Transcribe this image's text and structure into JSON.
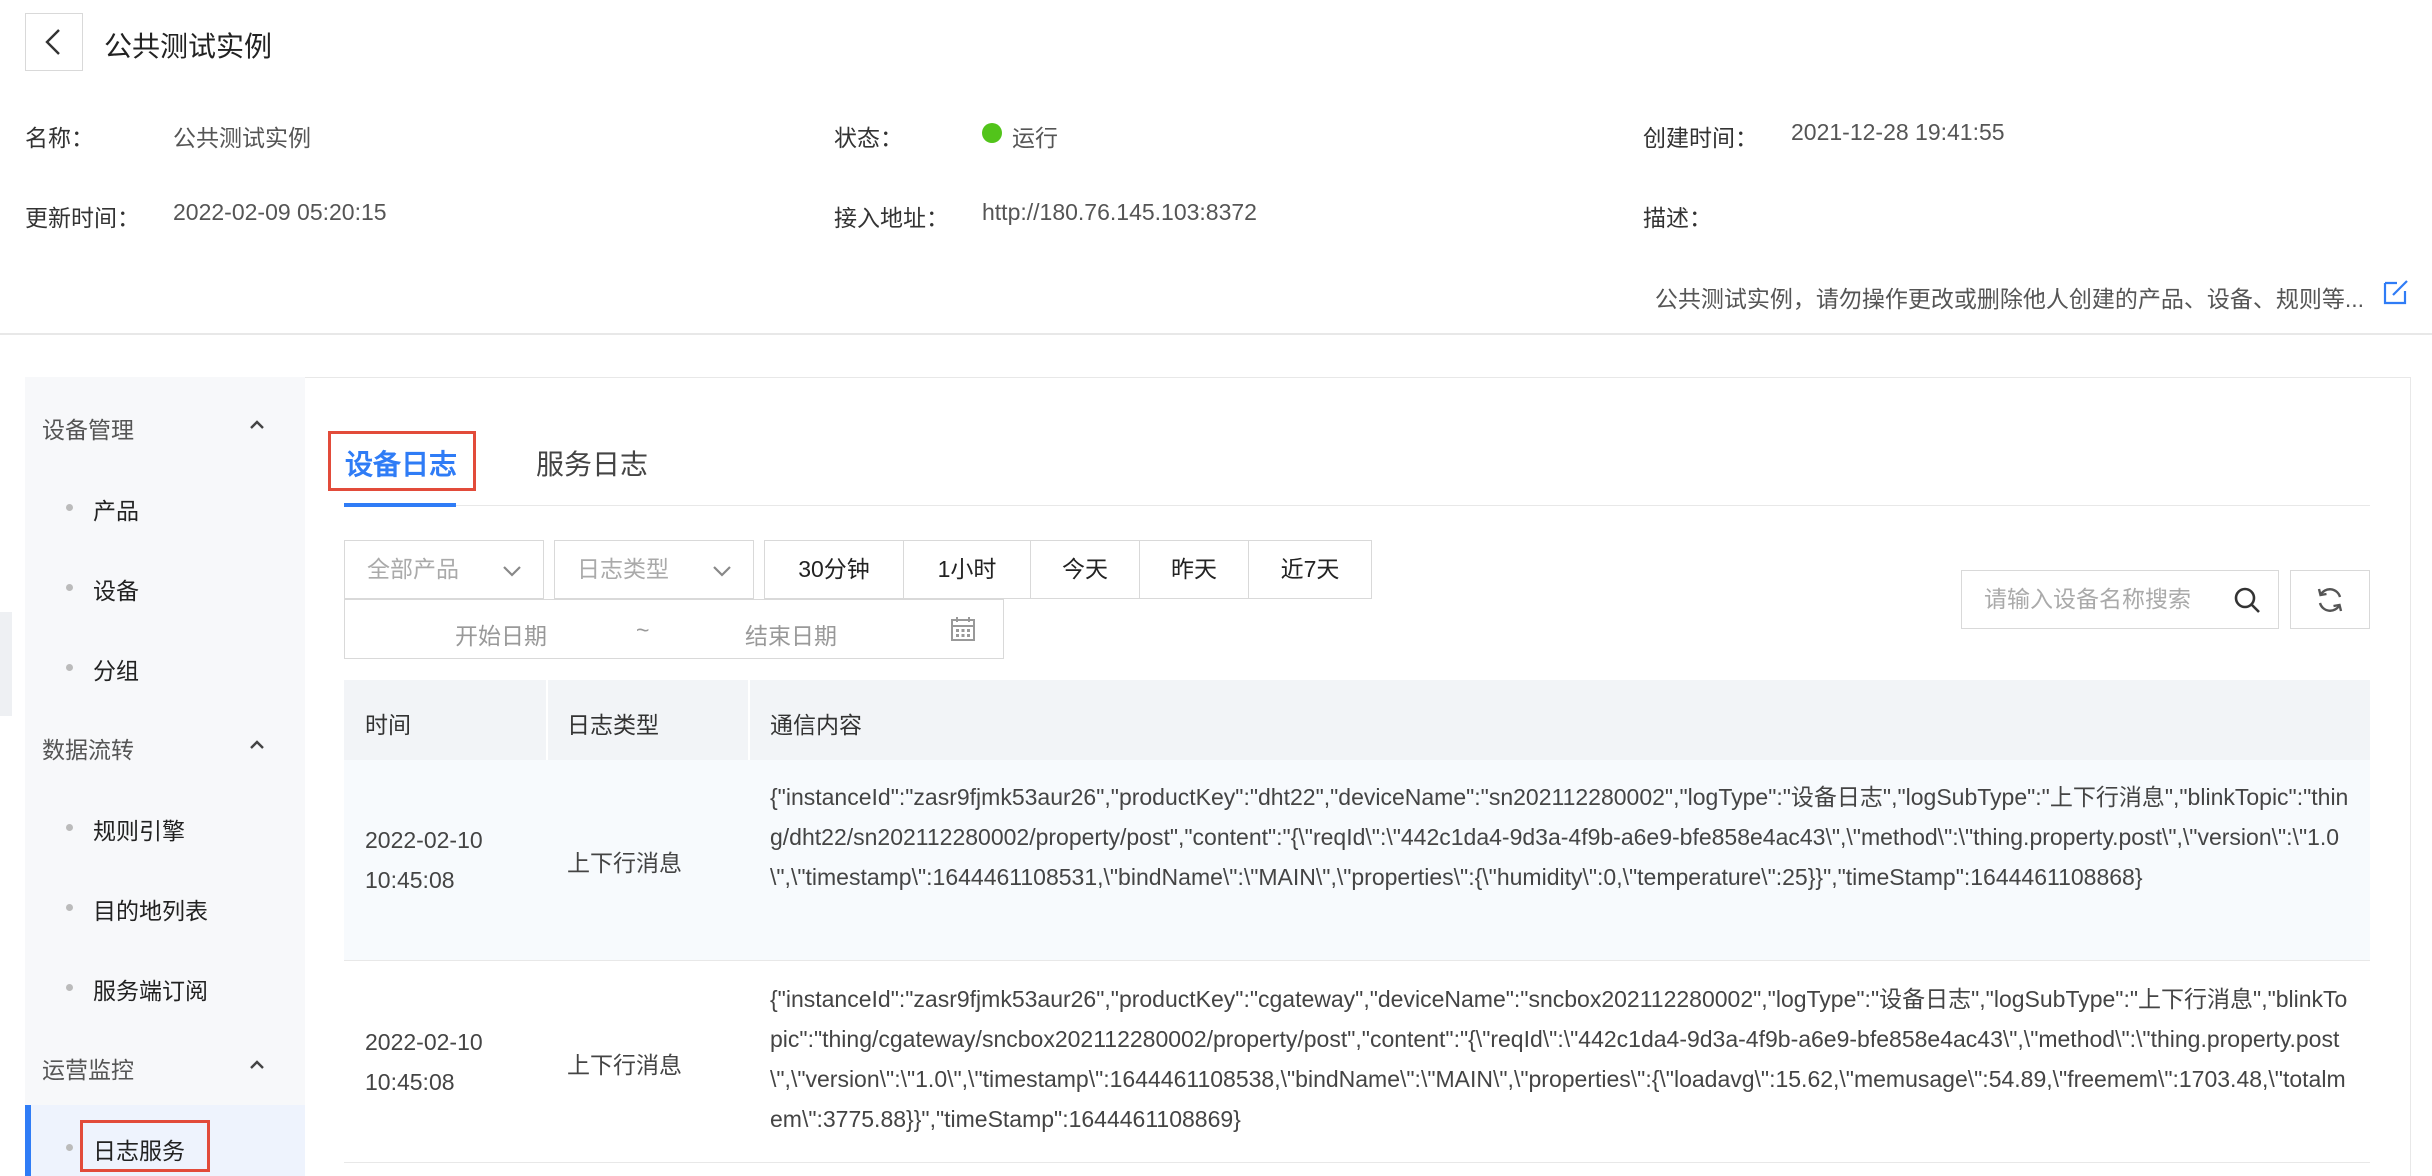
{
  "header": {
    "title": "公共测试实例"
  },
  "info": {
    "name_label": "名称：",
    "name_value": "公共测试实例",
    "status_label": "状态：",
    "status_value": "运行",
    "status_color": "#52c41a",
    "created_label": "创建时间：",
    "created_value": "2021-12-28 19:41:55",
    "updated_label": "更新时间：",
    "updated_value": "2022-02-09 05:20:15",
    "endpoint_label": "接入地址：",
    "endpoint_value": "http://180.76.145.103:8372",
    "desc_label": "描述：",
    "desc_value": "公共测试实例，请勿操作更改或删除他人创建的产品、设备、规则等..."
  },
  "sidebar": {
    "groups": [
      {
        "label": "设备管理",
        "items": [
          "产品",
          "设备",
          "分组"
        ]
      },
      {
        "label": "数据流转",
        "items": [
          "规则引擎",
          "目的地列表",
          "服务端订阅"
        ]
      },
      {
        "label": "运营监控",
        "items": [
          "日志服务"
        ]
      }
    ],
    "active_item": "日志服务"
  },
  "tabs": [
    {
      "label": "设备日志",
      "active": true
    },
    {
      "label": "服务日志",
      "active": false
    }
  ],
  "filters": {
    "product_select": "全部产品",
    "log_type_select": "日志类型",
    "ranges": [
      "30分钟",
      "1小时",
      "今天",
      "昨天",
      "近7天"
    ],
    "start_date_placeholder": "开始日期",
    "date_separator": "~",
    "end_date_placeholder": "结束日期",
    "search_placeholder": "请输入设备名称搜索"
  },
  "table": {
    "columns": [
      "时间",
      "日志类型",
      "通信内容"
    ],
    "rows": [
      {
        "time": "2022-02-10 10:45:08",
        "type": "上下行消息",
        "content": "{\"instanceId\":\"zasr9fjmk53aur26\",\"productKey\":\"dht22\",\"deviceName\":\"sn202112280002\",\"logType\":\"设备日志\",\"logSubType\":\"上下行消息\",\"blinkTopic\":\"thing/dht22/sn202112280002/property/post\",\"content\":\"{\\\"reqId\\\":\\\"442c1da4-9d3a-4f9b-a6e9-bfe858e4ac43\\\",\\\"method\\\":\\\"thing.property.post\\\",\\\"version\\\":\\\"1.0\\\",\\\"timestamp\\\":1644461108531,\\\"bindName\\\":\\\"MAIN\\\",\\\"properties\\\":{\\\"humidity\\\":0,\\\"temperature\\\":25}}\",\"timeStamp\":1644461108868}"
      },
      {
        "time": "2022-02-10 10:45:08",
        "type": "上下行消息",
        "content": "{\"instanceId\":\"zasr9fjmk53aur26\",\"productKey\":\"cgateway\",\"deviceName\":\"sncbox202112280002\",\"logType\":\"设备日志\",\"logSubType\":\"上下行消息\",\"blinkTopic\":\"thing/cgateway/sncbox202112280002/property/post\",\"content\":\"{\\\"reqId\\\":\\\"442c1da4-9d3a-4f9b-a6e9-bfe858e4ac43\\\",\\\"method\\\":\\\"thing.property.post\\\",\\\"version\\\":\\\"1.0\\\",\\\"timestamp\\\":1644461108538,\\\"bindName\\\":\\\"MAIN\\\",\\\"properties\\\":{\\\"loadavg\\\":15.62,\\\"memusage\\\":54.89,\\\"freemem\\\":1703.48,\\\"totalmem\\\":3775.88}}\",\"timeStamp\":1644461108869}"
      }
    ]
  },
  "colors": {
    "accent": "#2f7cf6",
    "highlight_box": "#e24b3a"
  }
}
